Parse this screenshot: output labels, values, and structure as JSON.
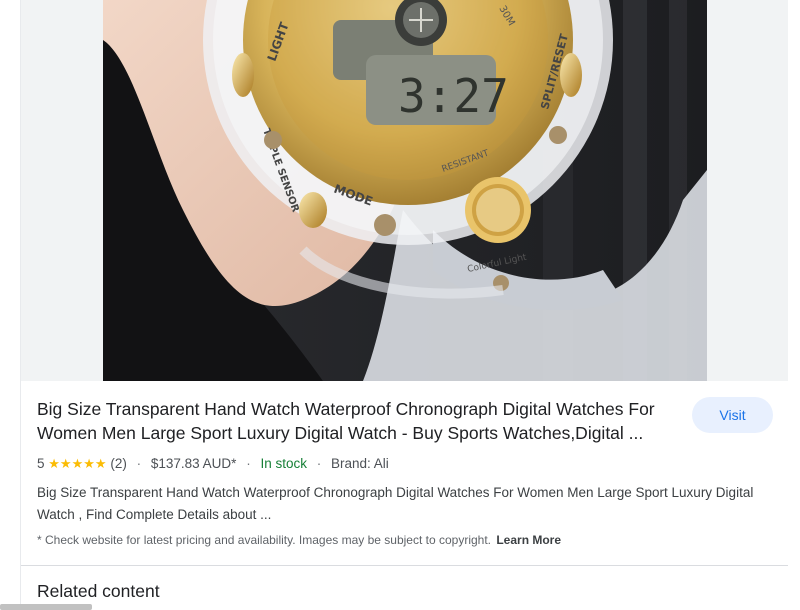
{
  "product": {
    "image_alt": "Transparent gold digital sports watch on wrist",
    "watch_labels": {
      "light": "LIGHT",
      "mode": "MODE",
      "reset": "SPLIT/RESET",
      "sensor": "TRIPLE SENSOR",
      "resistant": "RESISTANT",
      "depth": "30M",
      "brand": "Colorful Light",
      "display": "3:27"
    },
    "title": "Big Size Transparent Hand Watch Waterproof Chronograph Digital Watches For Women Men Large Sport Luxury Digital Watch - Buy Sports Watches,Digital ...",
    "visit_label": "Visit",
    "rating": "5",
    "stars": "★★★★★",
    "review_count": "(2)",
    "price": "$137.83 AUD*",
    "stock": "In stock",
    "brand": "Brand: Ali",
    "description": "Big Size Transparent Hand Watch Waterproof Chronograph Digital Watches For Women Men Large Sport Luxury Digital Watch , Find Complete Details about ...",
    "disclaimer": "* Check website for latest pricing and availability. Images may be subject to copyright.",
    "learn_more": "Learn More"
  },
  "related": {
    "heading": "Related content"
  },
  "colors": {
    "accent": "#1a73e8",
    "visit_bg": "#e8f0fe",
    "stock_green": "#188038",
    "star_yellow": "#fbbc04"
  }
}
